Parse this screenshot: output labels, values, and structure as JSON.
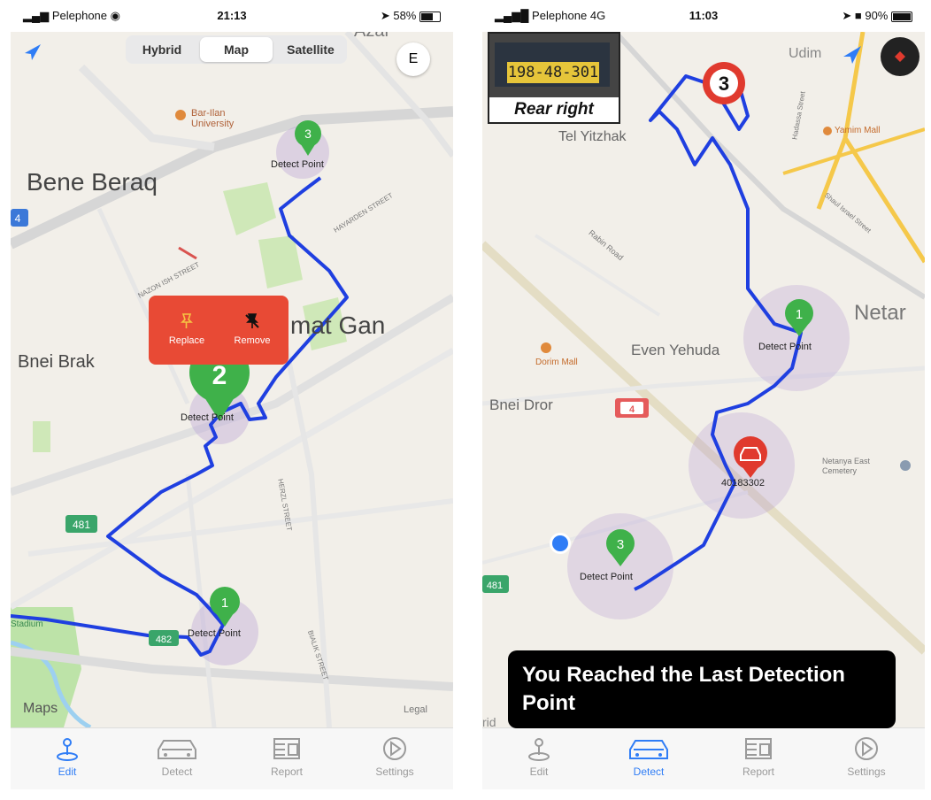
{
  "left": {
    "status": {
      "carrier": "Pelephone",
      "time": "21:13",
      "battery": "58%",
      "battery_level": 0.58
    },
    "map_types": [
      "Hybrid",
      "Map",
      "Satellite"
    ],
    "selected_map_type": "Map",
    "compass": "E",
    "place_labels": {
      "bene_beraq": "Bene Beraq",
      "bnei_brak": "Bnei Brak",
      "ramat_gan": "mat Gan",
      "university": "Bar-Ilan University",
      "azar": "Azar",
      "maps_logo": "Maps",
      "legal": "Legal",
      "highway": "4",
      "road_4": "481",
      "road_5": "482",
      "stadium": "Stadium"
    },
    "street_labels": {
      "hayarden": "HAYARDEN STREET",
      "nazon": "NAZON ISH STREET",
      "bialik": "BIALIK STREET",
      "herzl": "HERZL STREET"
    },
    "detect_points": [
      {
        "number": "3",
        "label": "Detect Point"
      },
      {
        "number": "2",
        "label": "Detect Point"
      },
      {
        "number": "1",
        "label": "Detect Point"
      }
    ],
    "popup": {
      "replace": "Replace",
      "remove": "Remove"
    },
    "tabs": [
      {
        "label": "Edit",
        "icon": "pin-icon",
        "active": true
      },
      {
        "label": "Detect",
        "icon": "car-icon",
        "active": false
      },
      {
        "label": "Report",
        "icon": "report-icon",
        "active": false
      },
      {
        "label": "Settings",
        "icon": "settings-icon",
        "active": false
      }
    ]
  },
  "right": {
    "status": {
      "carrier": "Pelephone",
      "network": "4G",
      "time": "11:03",
      "battery": "90%",
      "battery_level": 0.9
    },
    "plate": {
      "number": "198-48-301",
      "caption": "Rear right"
    },
    "place_labels": {
      "tel_yitzhak": "Tel Yitzhak",
      "udim": "Udim",
      "netanya": "Netar",
      "even_yehuda": "Even Yehuda",
      "bnei_dror": "Bnei Dror",
      "dror_mall": "Dorim Mall",
      "yamim_mall": "Yamim Mall",
      "netanya_cemetery": "Netanya East Cemetery",
      "rabin_road": "Rabin Road",
      "hadassa": "Hadassa Street",
      "shaul": "Shaul Israel Street",
      "road_4": "4",
      "road_2": "481",
      "rid": "rid"
    },
    "route_badge": "3",
    "detect_points": [
      {
        "number": "1",
        "label": "Detect Point"
      },
      {
        "number": "3",
        "label": "Detect Point"
      }
    ],
    "car_marker_label": "40183302",
    "toast": "You Reached the Last Detection Point",
    "tabs": [
      {
        "label": "Edit",
        "icon": "pin-icon",
        "active": false
      },
      {
        "label": "Detect",
        "icon": "car-icon",
        "active": true
      },
      {
        "label": "Report",
        "icon": "report-icon",
        "active": false
      },
      {
        "label": "Settings",
        "icon": "settings-icon",
        "active": false
      }
    ]
  },
  "colors": {
    "route": "#1f3fe0",
    "pin_green": "#3fb14a",
    "popup_red": "#e84a35",
    "tab_active": "#2f7df6",
    "road_yellow": "#f5c84a"
  }
}
